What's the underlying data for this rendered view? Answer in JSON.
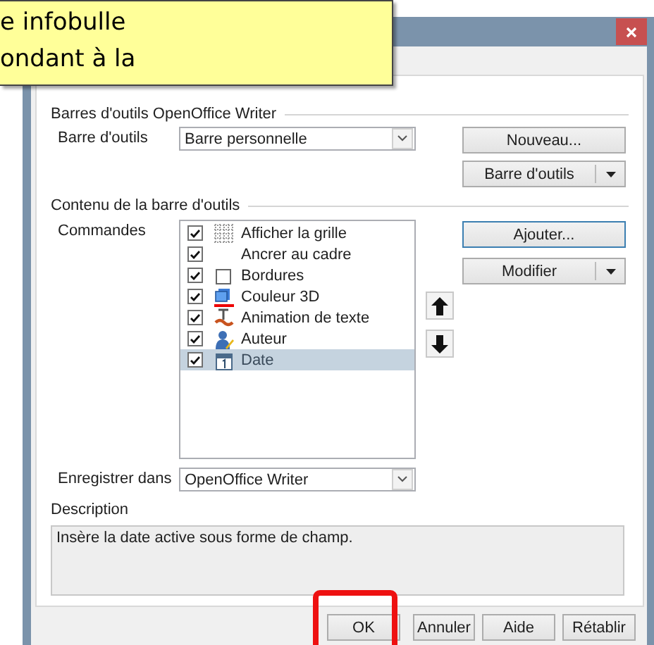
{
  "tooltip": {
    "lines": [
      "e infobulle",
      "ondant à la"
    ]
  },
  "toolbars_section": {
    "title": "Barres d'outils OpenOffice Writer",
    "toolbar_label": "Barre d'outils",
    "toolbar_value": "Barre personnelle",
    "new_button": "Nouveau...",
    "toolbar_menu_button": "Barre d'outils"
  },
  "contents_section": {
    "title": "Contenu de la barre d'outils",
    "commands_label": "Commandes",
    "commands": [
      {
        "label": "Afficher la grille",
        "checked": true,
        "selected": false,
        "kind": "grid"
      },
      {
        "label": "Ancrer au cadre",
        "checked": true,
        "selected": false,
        "kind": "none"
      },
      {
        "label": "Bordures",
        "checked": true,
        "selected": false,
        "kind": "border"
      },
      {
        "label": "Couleur 3D",
        "checked": true,
        "selected": false,
        "kind": "cube"
      },
      {
        "label": "Animation de texte",
        "checked": true,
        "selected": false,
        "kind": "animation"
      },
      {
        "label": "Auteur",
        "checked": true,
        "selected": false,
        "kind": "person"
      },
      {
        "label": "Date",
        "checked": true,
        "selected": true,
        "kind": "calendar"
      }
    ],
    "add_button": "Ajouter...",
    "modify_button": "Modifier",
    "save_in_label": "Enregistrer dans",
    "save_in_value": "OpenOffice Writer"
  },
  "description": {
    "label": "Description",
    "text": "Insère la date active sous forme de champ."
  },
  "buttons": [
    {
      "label": "OK",
      "highlighted": true
    },
    {
      "label": "Annuler",
      "highlighted": false
    },
    {
      "label": "Aide",
      "highlighted": false
    },
    {
      "label": "Rétablir",
      "highlighted": false
    }
  ]
}
